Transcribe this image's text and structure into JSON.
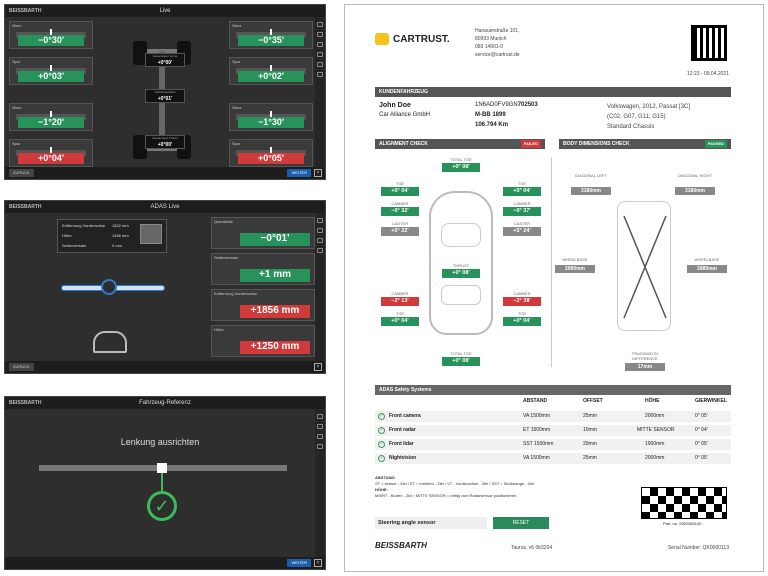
{
  "live": {
    "title": "Live",
    "logo": "BEISSBARTH",
    "footer_left": "ZURÜCK",
    "footer_right": "WEITER",
    "left": [
      {
        "label": "Sturz",
        "value": "−0°30'",
        "color": "green"
      },
      {
        "label": "Spur",
        "value": "+0°03'",
        "color": "green"
      },
      {
        "label": "Sturz",
        "value": "−1°20'",
        "color": "green"
      },
      {
        "label": "Spur",
        "value": "+0°04'",
        "color": "red"
      }
    ],
    "right": [
      {
        "label": "Sturz",
        "value": "−0°35'",
        "color": "green"
      },
      {
        "label": "Spur",
        "value": "+0°02'",
        "color": "green"
      },
      {
        "label": "Sturz",
        "value": "−1°30'",
        "color": "green"
      },
      {
        "label": "Spur",
        "value": "+0°05'",
        "color": "red"
      }
    ],
    "center": [
      {
        "label": "Gesamtspur vorne",
        "value": "+0°00'"
      },
      {
        "label": "Fahrachswinkel",
        "value": "+0°01'"
      },
      {
        "label": "Gesamtspur hinten",
        "value": "+0°00'"
      }
    ]
  },
  "adas": {
    "title": "ADAS Live",
    "footer_left": "ZURÜCK",
    "info": [
      {
        "label": "Entfernung Vorderachse",
        "value": "1822 mm"
      },
      {
        "label": "Höhe",
        "value": "1466 mm"
      },
      {
        "label": "Seitenversatz",
        "value": "0 mm"
      }
    ],
    "rows": [
      {
        "label": "Querabfall",
        "value": "−0°01'",
        "color": "green"
      },
      {
        "label": "Seitenversatz",
        "value": "+1 mm",
        "color": "green"
      },
      {
        "label": "Entfernung Vorderachse",
        "value": "+1856 mm",
        "color": "red"
      },
      {
        "label": "Höhe",
        "value": "+1250 mm",
        "color": "red"
      }
    ]
  },
  "ref": {
    "title": "Fahrzeug-Referenz",
    "message": "Lenkung ausrichten",
    "footer_right": "WEITER"
  },
  "report": {
    "brand": "CARTRUST.",
    "address": [
      "Hanauerstraße 101,",
      "80993 Munich",
      "089 14901-0",
      "service@cartrust.de"
    ],
    "datetime": "12:23 - 09.04.2021",
    "customer_section": "KUNDENFAHRZEUG",
    "name": "John Doe",
    "company": "Car Alliance GmbH",
    "vin_prefix": "1N6AD0FV9GN",
    "vin_suffix": "702503",
    "plate": "M-BB 1899",
    "km": "106.794 Km",
    "vehicle": [
      "Volkswagen, 2012, Passat [3C]",
      "(C02, G07, G11, G15)",
      "Standard Chassis"
    ],
    "alignment_title": "ALIGNMENT CHECK",
    "alignment_tag": "FAILED",
    "body_title": "BODY DIMENSIONS CHECK",
    "body_tag": "PASSED",
    "total_toe": "TOTAL TOE",
    "total_toe_front": "+0° 08'",
    "total_toe_rear": "+0° 08'",
    "toe": "TOE",
    "camber": "CAMBER",
    "caster": "CASTER",
    "thrust": "THRUST",
    "fl": {
      "toe": "+0° 04'",
      "camber": "−0° 32'",
      "caster": "+5° 22'"
    },
    "fr": {
      "toe": "+0° 04'",
      "camber": "−0° 37'",
      "caster": "+5° 24'"
    },
    "rl": {
      "camber": "−2° 13'",
      "toe": "+0° 04'"
    },
    "rr": {
      "camber": "−2° 38'",
      "toe": "+0° 04'"
    },
    "thrust_val": "+0° 08'",
    "diag_left": "DIAGONAL LEFT",
    "diag_left_val": "3180mm",
    "diag_right": "DIAGONAL RIGHT",
    "diag_right_val": "3180mm",
    "wheelbase": "WHEELBASE",
    "wb_left": "2980mm",
    "wb_right": "2985mm",
    "track_diff": "TRACKWIDTH DIFFERENCE",
    "track_val": "17mm",
    "adas_title": "ADAS Safety Systems",
    "cols": [
      "ABSTAND",
      "OFFSET",
      "HÖHE",
      "GIERWINKEL"
    ],
    "rows": [
      {
        "name": "Front camera",
        "abstand": "VA 1500mm",
        "offset": "25mm",
        "hoehe": "2000mm",
        "gier": "0° 05'"
      },
      {
        "name": "Front radar",
        "abstand": "ET 1500mm",
        "offset": "10mm",
        "hoehe": "MITTE SENSOR",
        "gier": "0° 04'"
      },
      {
        "name": "Front lidar",
        "abstand": "SST 1500mm",
        "offset": "20mm",
        "hoehe": "1900mm",
        "gier": "0° 05'"
      },
      {
        "name": "Nightvision",
        "abstand": "VA 1500mm",
        "offset": "25mm",
        "hoehe": "2000mm",
        "gier": "0° 05'"
      }
    ],
    "legend": [
      "ABSTAND:",
      "ST = sensor - Ziel / ET = emblem - Ziel / VT - Vorderachse - Ziel / SST = Stoßstange - Ziel",
      "HÖHE:",
      "MIERT - Boden - Ziel / MITTE SENSOR = mittig zum Radarsensor positionieren"
    ],
    "steer_label": "Steering angle sensor",
    "reset": "RESET",
    "part_no": "Part. no. 9902083140",
    "footer_brand": "BEISSBARTH",
    "footer_mid": "Taurus, v6 0b3204",
    "serial": "Serial Number: QK0000113"
  }
}
